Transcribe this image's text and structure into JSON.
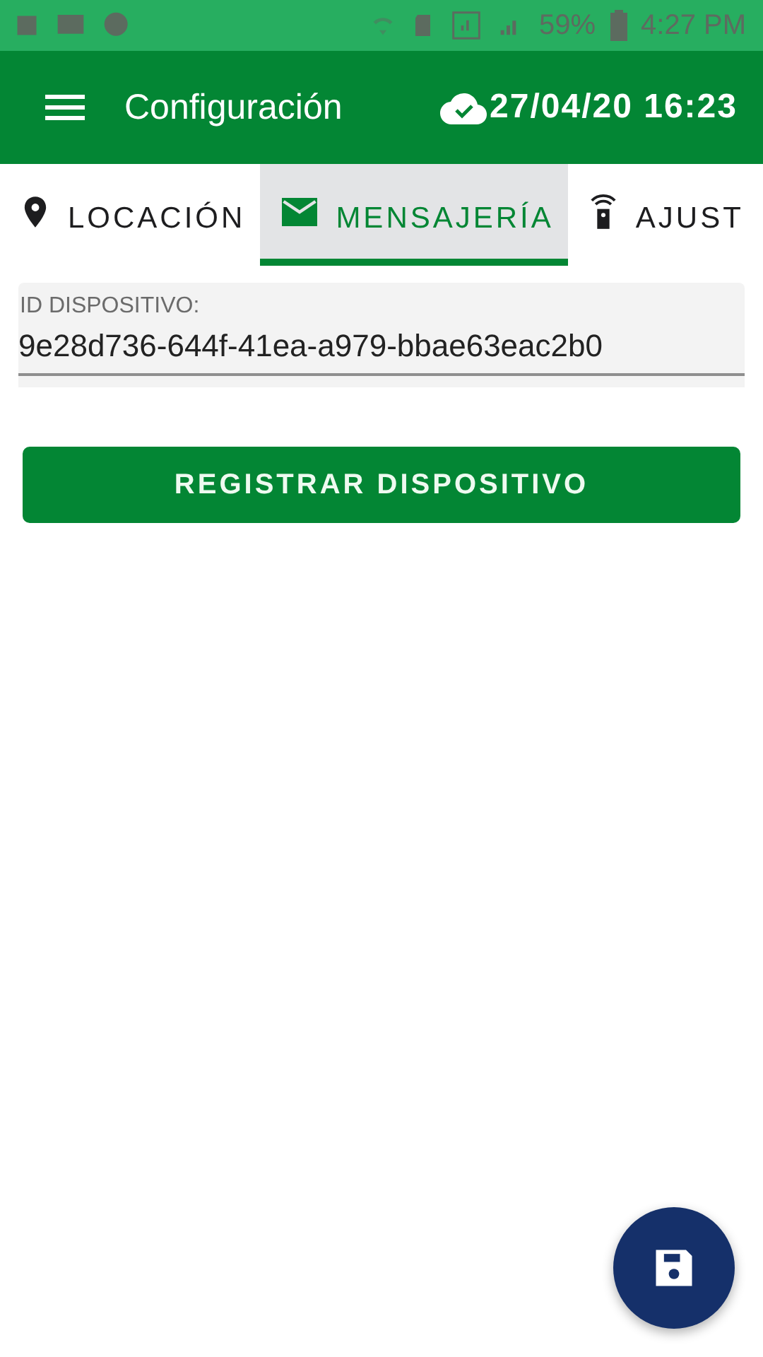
{
  "status_bar": {
    "battery": "59%",
    "time": "4:27 PM"
  },
  "app_bar": {
    "title": "Configuración",
    "sync_time": "27/04/20 16:23"
  },
  "tabs": [
    {
      "label": "LOCACIÓN",
      "kind": "location",
      "selected": false
    },
    {
      "label": "MENSAJERÍA",
      "kind": "message",
      "selected": true
    },
    {
      "label": "AJUST",
      "kind": "remote",
      "selected": false
    }
  ],
  "device_field": {
    "label": "ID DISPOSITIVO:",
    "value": "9e28d736-644f-41ea-a979-bbae63eac2b0"
  },
  "register_button": "REGISTRAR DISPOSITIVO"
}
